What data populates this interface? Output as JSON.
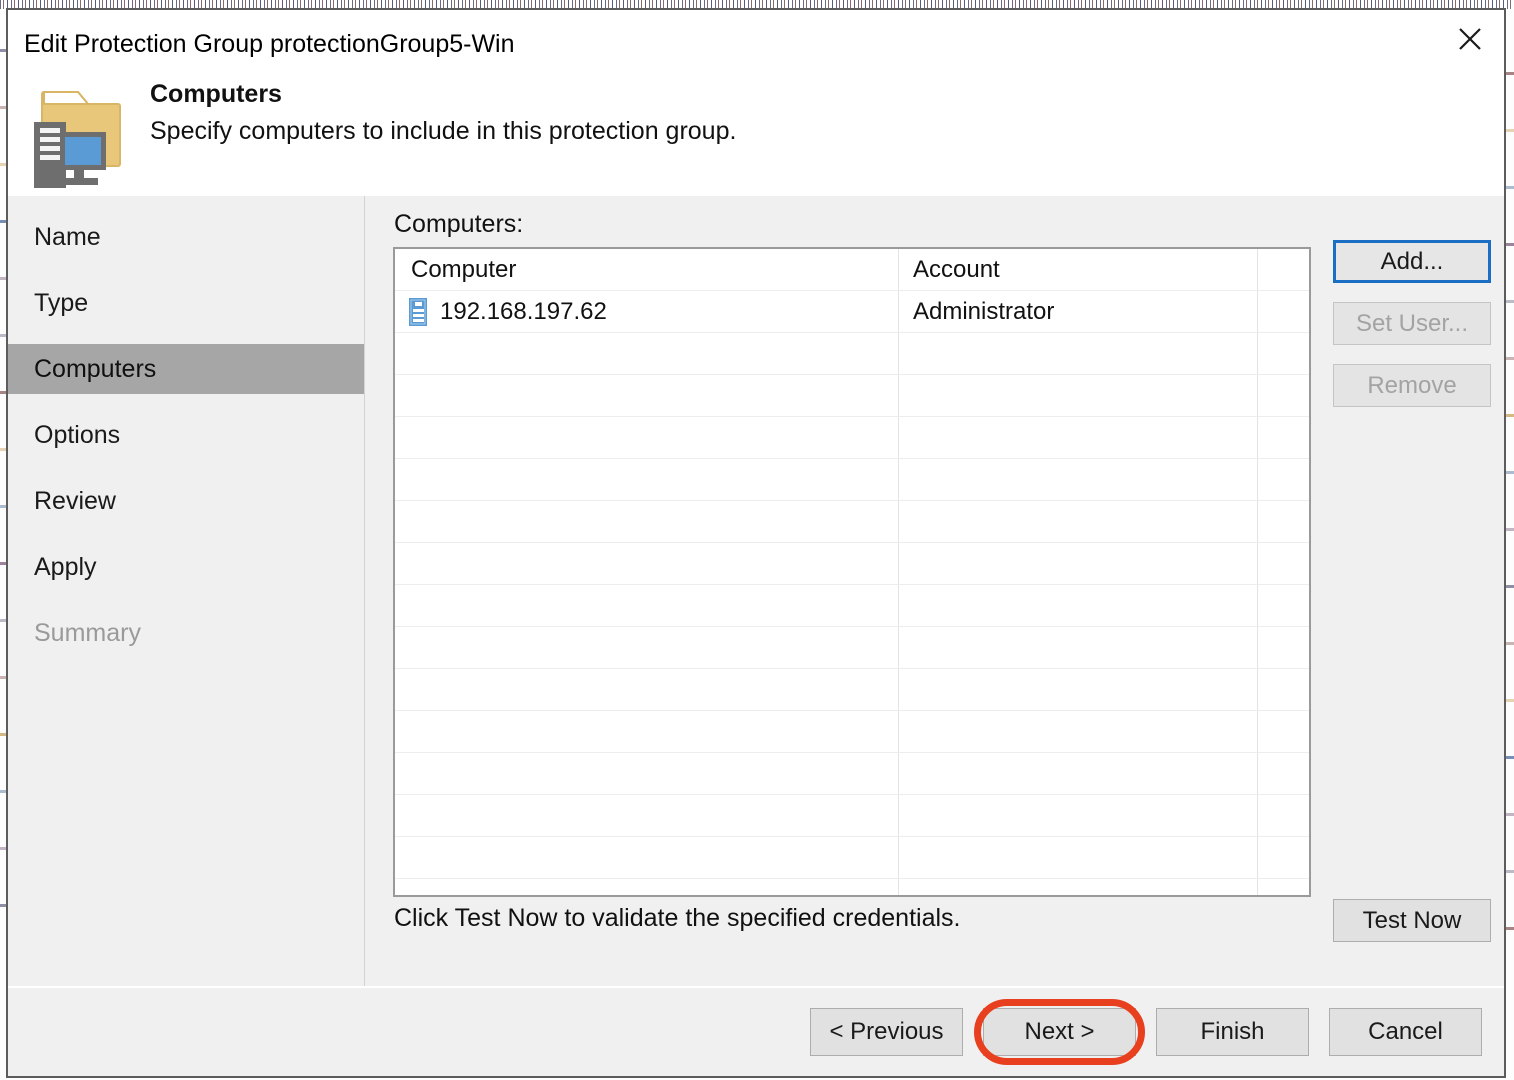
{
  "window": {
    "title": "Edit Protection Group protectionGroup5-Win",
    "close_icon": "close-icon"
  },
  "header": {
    "icon": "computer-folder-icon",
    "heading": "Computers",
    "subtitle": "Specify computers to include in this protection group.",
    "colors": {
      "folder": "#e8c77a",
      "tower": "#6e6e6e",
      "monitor": "#5b9bd5"
    }
  },
  "sidebar": {
    "items": [
      {
        "label": "Name",
        "state": "normal"
      },
      {
        "label": "Type",
        "state": "normal"
      },
      {
        "label": "Computers",
        "state": "active"
      },
      {
        "label": "Options",
        "state": "normal"
      },
      {
        "label": "Review",
        "state": "normal"
      },
      {
        "label": "Apply",
        "state": "normal"
      },
      {
        "label": "Summary",
        "state": "disabled"
      }
    ],
    "active_bg": "#a6a6a6"
  },
  "main": {
    "list_label": "Computers:",
    "table": {
      "columns": [
        "Computer",
        "Account",
        ""
      ],
      "rows": [
        {
          "icon": "server-icon",
          "computer": "192.168.197.62",
          "account": "Administrator"
        }
      ],
      "empty_row_count": 14,
      "row_icon_color": "#5b9bd5"
    },
    "side_buttons": [
      {
        "label": "Add...",
        "state": "focused"
      },
      {
        "label": "Set User...",
        "state": "disabled"
      },
      {
        "label": "Remove",
        "state": "disabled"
      }
    ],
    "hint": "Click Test Now to validate the specified credentials.",
    "test_button": {
      "label": "Test Now",
      "state": "normal"
    }
  },
  "footer": {
    "buttons": [
      {
        "label": "< Previous",
        "state": "normal",
        "highlighted": false
      },
      {
        "label": "Next >",
        "state": "normal",
        "highlighted": true
      },
      {
        "label": "Finish",
        "state": "normal",
        "highlighted": false
      },
      {
        "label": "Cancel",
        "state": "normal",
        "highlighted": false
      }
    ],
    "annotation_color": "#e8401f"
  }
}
